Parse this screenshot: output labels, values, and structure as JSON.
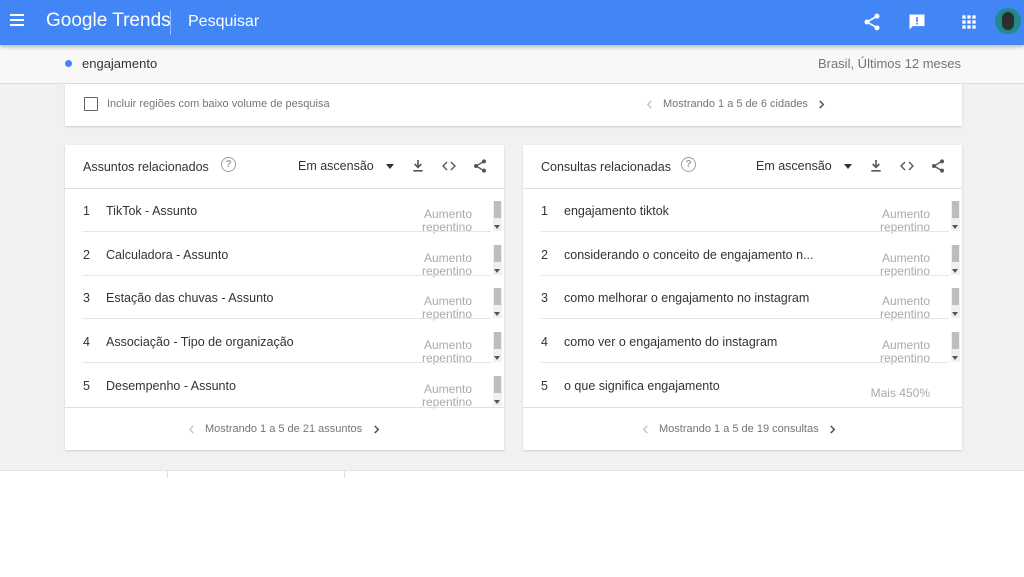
{
  "header": {
    "logo_text": "Google Trends",
    "page_title": "Pesquisar",
    "bg_color": "#4285f4",
    "icons": [
      "menu-icon",
      "share-icon",
      "feedback-icon",
      "apps-icon",
      "avatar"
    ]
  },
  "search_term": {
    "label": "engajamento",
    "meta": "Brasil, Últimos 12 meses",
    "dot_color": "#4285f4"
  },
  "regions": {
    "checkbox_label": "Incluir regiões com baixo volume de pesquisa",
    "checked": false,
    "pager_text": "Mostrando 1 a 5 de 6 cidades"
  },
  "related_topics": {
    "title": "Assuntos relacionados",
    "dropdown_value": "Em ascensão",
    "items": [
      {
        "rank": "1",
        "label": "TikTok - Assunto",
        "value_line1": "Aumento",
        "value_line2": "repentino"
      },
      {
        "rank": "2",
        "label": "Calculadora - Assunto",
        "value_line1": "Aumento",
        "value_line2": "repentino"
      },
      {
        "rank": "3",
        "label": "Estação das chuvas - Assunto",
        "value_line1": "Aumento",
        "value_line2": "repentino"
      },
      {
        "rank": "4",
        "label": "Associação - Tipo de organização",
        "value_line1": "Aumento",
        "value_line2": "repentino"
      },
      {
        "rank": "5",
        "label": "Desempenho - Assunto",
        "value_line1": "Aumento",
        "value_line2": "repentino"
      }
    ],
    "pager_text": "Mostrando 1 a 5 de 21 assuntos"
  },
  "related_queries": {
    "title": "Consultas relacionadas",
    "dropdown_value": "Em ascensão",
    "items": [
      {
        "rank": "1",
        "label": "engajamento tiktok",
        "value_line1": "Aumento",
        "value_line2": "repentino"
      },
      {
        "rank": "2",
        "label": "considerando o conceito de engajamento n...",
        "value_line1": "Aumento",
        "value_line2": "repentino"
      },
      {
        "rank": "3",
        "label": "como melhorar o engajamento no instagram",
        "value_line1": "Aumento",
        "value_line2": "repentino"
      },
      {
        "rank": "4",
        "label": "como ver o engajamento do instagram",
        "value_line1": "Aumento",
        "value_line2": "repentino"
      },
      {
        "rank": "5",
        "label": "o que significa engajamento",
        "value_line1": "Mais 450%",
        "value_line2": ""
      }
    ],
    "pager_text": "Mostrando 1 a 5 de 19 consultas"
  }
}
